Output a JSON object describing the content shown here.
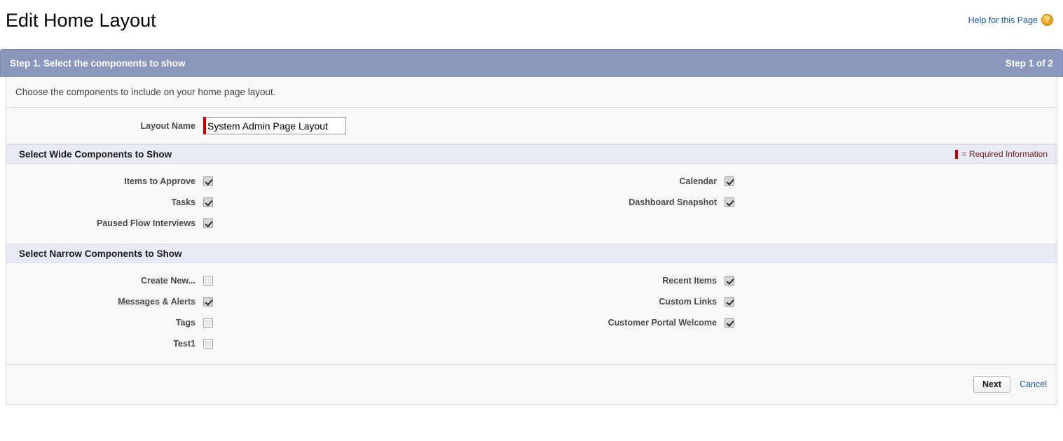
{
  "header": {
    "page_title": "Edit Home Layout",
    "help_link": "Help for this Page",
    "help_icon": "question-mark-circle-icon"
  },
  "step_bar": {
    "title": "Step 1. Select the components to show",
    "step_count": "Step 1 of 2"
  },
  "description": "Choose the components to include on your home page layout.",
  "layout_name": {
    "label": "Layout Name",
    "value": "System Admin Page Layout",
    "required": true
  },
  "required_legend": "= Required Information",
  "sections": [
    {
      "title": "Select Wide Components to Show",
      "left_items": [
        {
          "label": "Items to Approve",
          "checked": true
        },
        {
          "label": "Tasks",
          "checked": true
        },
        {
          "label": "Paused Flow Interviews",
          "checked": true
        }
      ],
      "right_items": [
        {
          "label": "Calendar",
          "checked": true
        },
        {
          "label": "Dashboard Snapshot",
          "checked": true
        }
      ]
    },
    {
      "title": "Select Narrow Components to Show",
      "left_items": [
        {
          "label": "Create New...",
          "checked": false
        },
        {
          "label": "Messages & Alerts",
          "checked": true
        },
        {
          "label": "Tags",
          "checked": false
        },
        {
          "label": "Test1",
          "checked": false
        }
      ],
      "right_items": [
        {
          "label": "Recent Items",
          "checked": true
        },
        {
          "label": "Custom Links",
          "checked": true
        },
        {
          "label": "Customer Portal Welcome",
          "checked": true
        }
      ]
    }
  ],
  "footer": {
    "next_label": "Next",
    "cancel_label": "Cancel"
  },
  "colors": {
    "step_bar_bg": "#8a96bc",
    "section_head_bg": "#e8ebf5",
    "required_red": "#c60000",
    "link_blue": "#1B5FAA",
    "help_icon_orange": "#f0a11a"
  }
}
